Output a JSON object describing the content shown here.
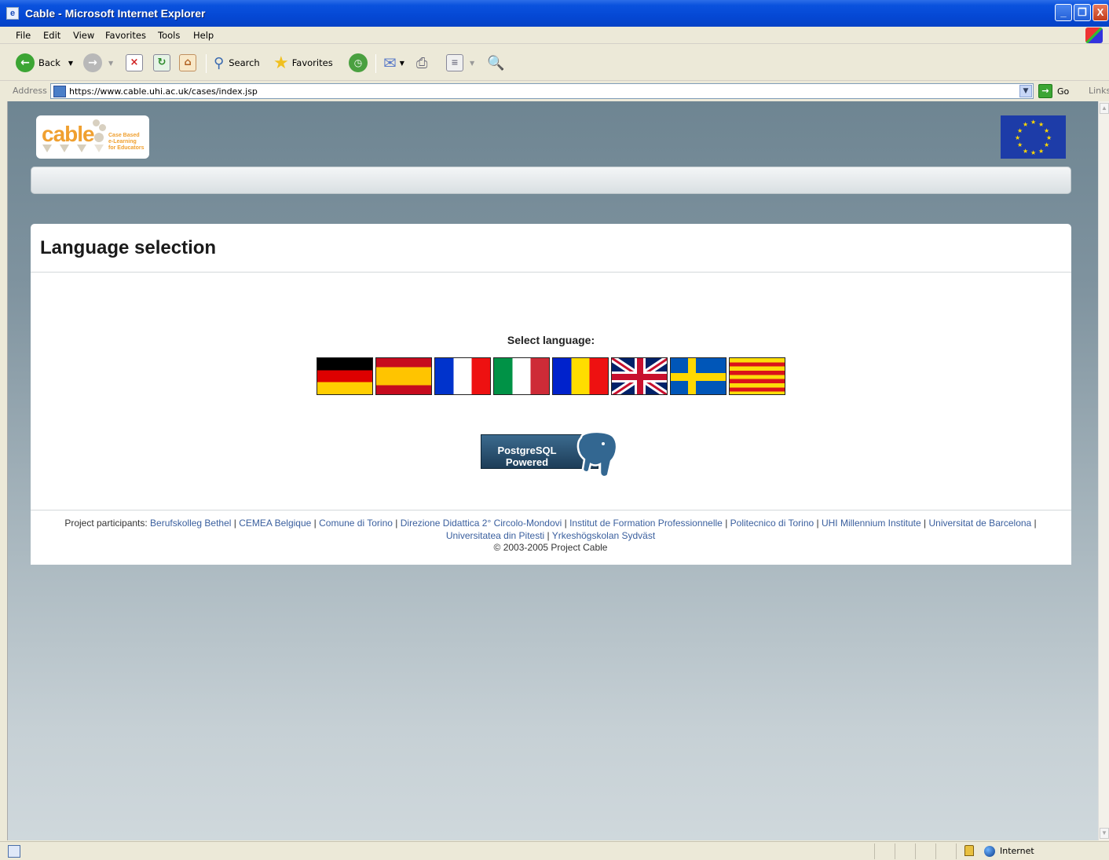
{
  "window": {
    "title": "Cable - Microsoft Internet Explorer",
    "min_label": "_",
    "max_label": "❐",
    "close_label": "X"
  },
  "menu": {
    "items": [
      {
        "label": "File"
      },
      {
        "label": "Edit"
      },
      {
        "label": "View"
      },
      {
        "label": "Favorites"
      },
      {
        "label": "Tools"
      },
      {
        "label": "Help"
      }
    ]
  },
  "toolbar": {
    "back_label": "Back",
    "search_label": "Search",
    "favorites_label": "Favorites"
  },
  "address": {
    "label": "Address",
    "url": "https://www.cable.uhi.ac.uk/cases/index.jsp",
    "go_label": "Go",
    "links_label": "Links"
  },
  "page": {
    "logo": {
      "word": "cable",
      "tagline_1": "Case Based",
      "tagline_2": "e-Learning",
      "tagline_3": "for Educators"
    },
    "heading": "Language selection",
    "select_label": "Select language:",
    "flags": [
      {
        "name": "german"
      },
      {
        "name": "spanish"
      },
      {
        "name": "french"
      },
      {
        "name": "italian"
      },
      {
        "name": "romanian"
      },
      {
        "name": "english"
      },
      {
        "name": "swedish"
      },
      {
        "name": "catalan"
      }
    ],
    "postgres": {
      "line1": "PostgreSQL",
      "line2": "Powered"
    },
    "footer": {
      "prefix": "Project participants: ",
      "participants": [
        "Berufskolleg Bethel",
        "CEMEA Belgique",
        "Comune di Torino",
        "Direzione Didattica 2° Circolo-Mondovi",
        "Institut de Formation Professionnelle",
        "Politecnico di Torino",
        "UHI Millennium Institute",
        "Universitat de Barcelona",
        "Universitatea din Pitesti",
        "Yrkeshögskolan Sydväst"
      ],
      "separator": " | ",
      "copyright": "© 2003-2005 Project Cable"
    }
  },
  "status": {
    "zone": "Internet"
  },
  "colors": {
    "title_blue": "#0548d4",
    "link": "#3a5f9e",
    "logo_orange": "#f0a030",
    "eu_blue": "#1d3ca8"
  }
}
